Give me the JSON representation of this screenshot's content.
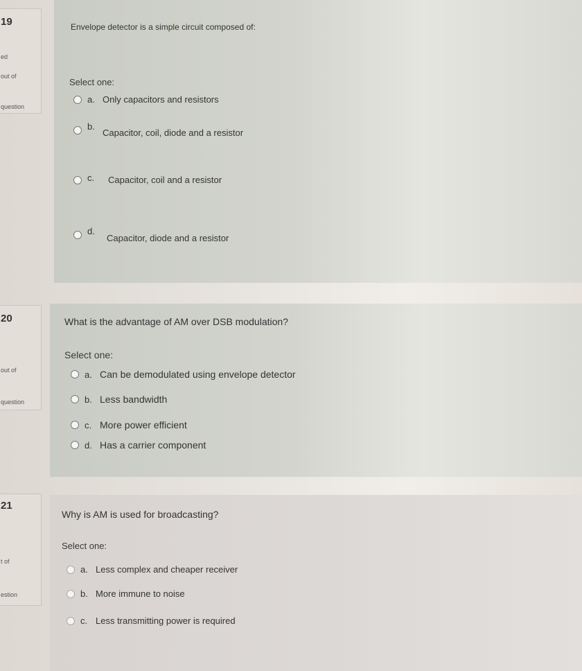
{
  "questions": [
    {
      "number": "19",
      "state": "ed",
      "mark": "out of",
      "flag": "question",
      "text": "Envelope detector is a simple circuit composed of:",
      "prompt": "Select one:",
      "options": [
        {
          "letter": "a.",
          "label": "Only capacitors and resistors"
        },
        {
          "letter": "b.",
          "label": "Capacitor, coil, diode and a resistor"
        },
        {
          "letter": "c.",
          "label": "Capacitor, coil and a resistor"
        },
        {
          "letter": "d.",
          "label": "Capacitor, diode and a resistor"
        }
      ]
    },
    {
      "number": "20",
      "state": "",
      "mark": "out of",
      "flag": "question",
      "text": "What is the advantage of AM over DSB modulation?",
      "prompt": "Select one:",
      "options": [
        {
          "letter": "a.",
          "label": "Can be demodulated using envelope detector"
        },
        {
          "letter": "b.",
          "label": "Less bandwidth"
        },
        {
          "letter": "c.",
          "label": "More power efficient"
        },
        {
          "letter": "d.",
          "label": "Has a carrier component"
        }
      ]
    },
    {
      "number": "21",
      "state": "",
      "mark": "t of",
      "flag": "estion",
      "text": "Why is AM is used for broadcasting?",
      "prompt": "Select one:",
      "options": [
        {
          "letter": "a.",
          "label": "Less complex and cheaper receiver"
        },
        {
          "letter": "b.",
          "label": "More immune to noise"
        },
        {
          "letter": "c.",
          "label": "Less transmitting power is required"
        }
      ]
    }
  ]
}
